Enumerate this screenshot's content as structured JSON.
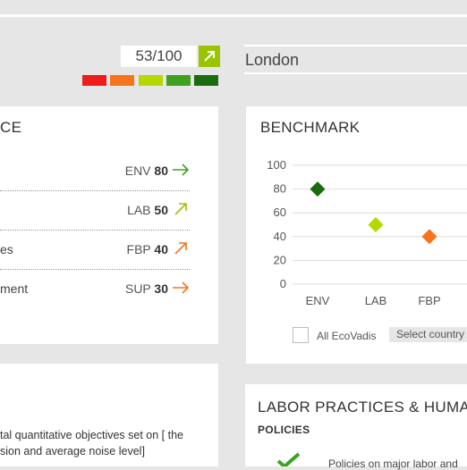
{
  "header": {
    "score": "53/100",
    "score_arrow_icon": "arrow-up-right-icon",
    "swatches": [
      "#ee1c1c",
      "#f7731c",
      "#b5d800",
      "#3fa21f",
      "#1b6b0f"
    ],
    "location": "London"
  },
  "performance": {
    "title": "CE",
    "rows": [
      {
        "label": "",
        "code": "ENV",
        "score": "80",
        "arrow": "arrow-right-icon",
        "color": "#3fa21f"
      },
      {
        "label": "",
        "code": "LAB",
        "score": "50",
        "arrow": "arrow-up-right-icon",
        "color": "#9bc400"
      },
      {
        "label": "es",
        "code": "FBP",
        "score": "40",
        "arrow": "arrow-up-right-icon",
        "color": "#f7731c"
      },
      {
        "label": "ment",
        "code": "SUP",
        "score": "30",
        "arrow": "arrow-right-icon",
        "color": "#f7731c"
      }
    ]
  },
  "benchmark": {
    "title": "BENCHMARK",
    "all_ecovadis_label": "All EcoVadis",
    "select_country_label": "Select country"
  },
  "chart_data": {
    "type": "scatter",
    "categories": [
      "ENV",
      "LAB",
      "FBP"
    ],
    "values": [
      80,
      50,
      40
    ],
    "colors": [
      "#1b6b0f",
      "#b5d800",
      "#f7731c"
    ],
    "yticks": [
      "100",
      "80",
      "60",
      "40",
      "20",
      "0"
    ],
    "ylim": [
      0,
      100
    ],
    "grid": true
  },
  "objectives": {
    "line1": "tal quantitative objectives set on [ the",
    "line2": "sion and average noise level]"
  },
  "labor": {
    "title": "LABOR PRACTICES & HUMAN",
    "policies_label": "POLICIES",
    "policy_text": "Policies on major labor and",
    "check_icon": "checkmark-icon"
  }
}
